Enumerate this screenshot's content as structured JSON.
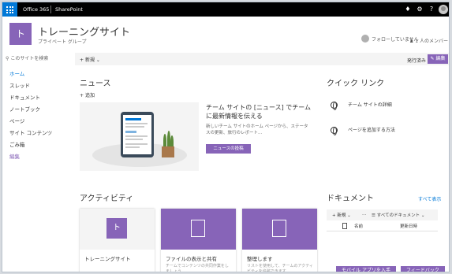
{
  "suite_bar": {
    "app_name": "Office 365",
    "product_name": "SharePoint",
    "icons": [
      "waffle-icon",
      "bell-icon",
      "gear-icon",
      "help-icon",
      "avatar"
    ]
  },
  "site": {
    "logo_letter": "ト",
    "title": "トレーニングサイト",
    "subtitle": "プライベート グループ",
    "follow_label": "フォローしていません",
    "members_label": "1 人のメンバー"
  },
  "search": {
    "placeholder": "このサイトを検索"
  },
  "nav": {
    "items": [
      "ホーム",
      "スレッド",
      "ドキュメント",
      "ノートブック",
      "ページ",
      "サイト コンテンツ",
      "ごみ箱",
      "編集"
    ],
    "active_index": 0
  },
  "command_bar": {
    "new_label": "新規",
    "published_label": "発行済み",
    "edit_label": "編集"
  },
  "news": {
    "heading": "ニュース",
    "add_label": "追加",
    "hero_title": "チーム サイトの [ニュース] でチームに最新情報を伝える",
    "hero_desc": "新しいチーム サイトのホーム ページから、ステータスの更新、旅行のレポート...",
    "hero_button": "ニュースの投稿"
  },
  "quick_links": {
    "heading": "クイック リンク",
    "items": [
      "チーム サイトの詳細",
      "ページを追加する方法"
    ]
  },
  "activity": {
    "heading": "アクティビティ",
    "cards": [
      {
        "title": "トレーニングサイト",
        "desc": ""
      },
      {
        "title": "ファイルの表示と共有",
        "desc": "チームでコンテンツの共同作業をしましょう"
      },
      {
        "title": "整理します",
        "desc": "リストを使用して、チームのアクティビティを追跡できます"
      }
    ]
  },
  "documents": {
    "heading": "ドキュメント",
    "see_all": "すべて表示",
    "new_label": "新規",
    "more_label": "…",
    "view_label": "すべてのドキュメント",
    "col_name": "名前",
    "col_modified": "更新日時"
  },
  "footer": {
    "mobile_button": "モバイル アプリを入手",
    "feedback_button": "フィードバック"
  },
  "colors": {
    "accent": "#8764b8",
    "link": "#0078d7",
    "suite_bar": "#000000"
  }
}
